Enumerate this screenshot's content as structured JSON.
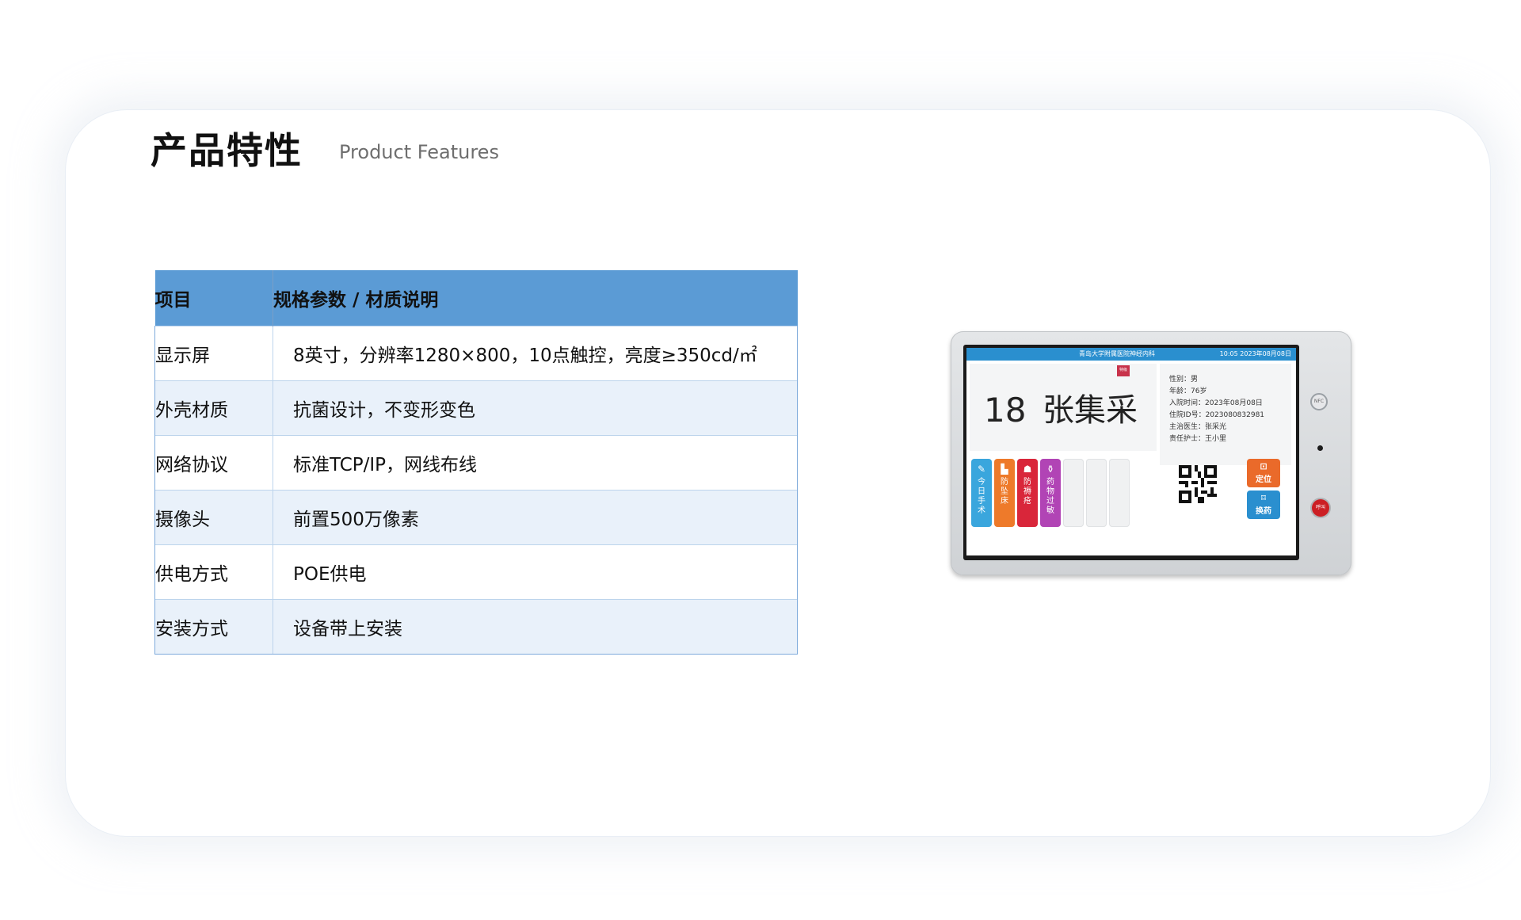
{
  "title": "产品特性",
  "subtitle": "Product Features",
  "table": {
    "headers": [
      "项目",
      "规格参数 / 材质说明"
    ],
    "rows": [
      {
        "item": "显示屏",
        "spec": "8英寸，分辨率1280×800，10点触控，亮度≥350cd/㎡"
      },
      {
        "item": "外壳材质",
        "spec": "抗菌设计，不变形变色"
      },
      {
        "item": "网络协议",
        "spec": "标准TCP/IP，网线布线"
      },
      {
        "item": "摄像头",
        "spec": "前置500万像素"
      },
      {
        "item": "供电方式",
        "spec": "POE供电"
      },
      {
        "item": "安装方式",
        "spec": "设备带上安装"
      }
    ]
  },
  "device": {
    "hospital": "青岛大学附属医院神经内科",
    "time": "10:05  2023年08月08日",
    "ribbon": "特级",
    "bed": "18",
    "patient_name": "张集采",
    "info": [
      "性别：男",
      "年龄：76岁",
      "入院时间：2023年08月08日",
      "住院ID号：2023080832981",
      "主治医生：张采光",
      "责任护士：王小里"
    ],
    "tags": [
      {
        "label": "今日手术",
        "color": "#3aa6dd",
        "icon": "pen-icon"
      },
      {
        "label": "防坠床",
        "color": "#ee7a2a",
        "icon": "bed-icon"
      },
      {
        "label": "防褥疮",
        "color": "#d9263a",
        "icon": "turtle-icon"
      },
      {
        "label": "药物过敏",
        "color": "#b144b5",
        "icon": "medicine-icon"
      }
    ],
    "actions": [
      {
        "label": "定位",
        "color": "#ea6a2a",
        "icon": "location-icon"
      },
      {
        "label": "换药",
        "color": "#2a8fcf",
        "icon": "medicine-change-icon"
      }
    ],
    "nfc": "NFC",
    "call": "呼叫"
  }
}
